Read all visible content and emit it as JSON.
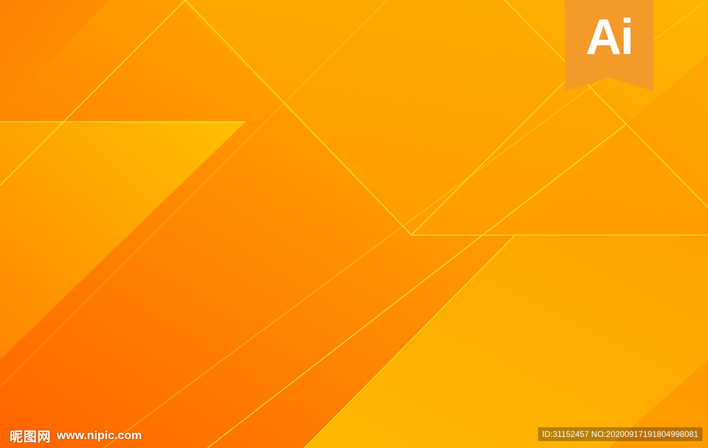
{
  "badge": {
    "label": "Ai",
    "color": "#f39a28"
  },
  "watermark": {
    "site_name": "昵图网",
    "site_url": "www.nipic.com",
    "id_text": "ID:31152457 NO:20200917191804998081"
  },
  "colors": {
    "gradient_orange": "#ff6a00",
    "gradient_yellow": "#ffc400",
    "line_yellow": "#ffe23a"
  }
}
